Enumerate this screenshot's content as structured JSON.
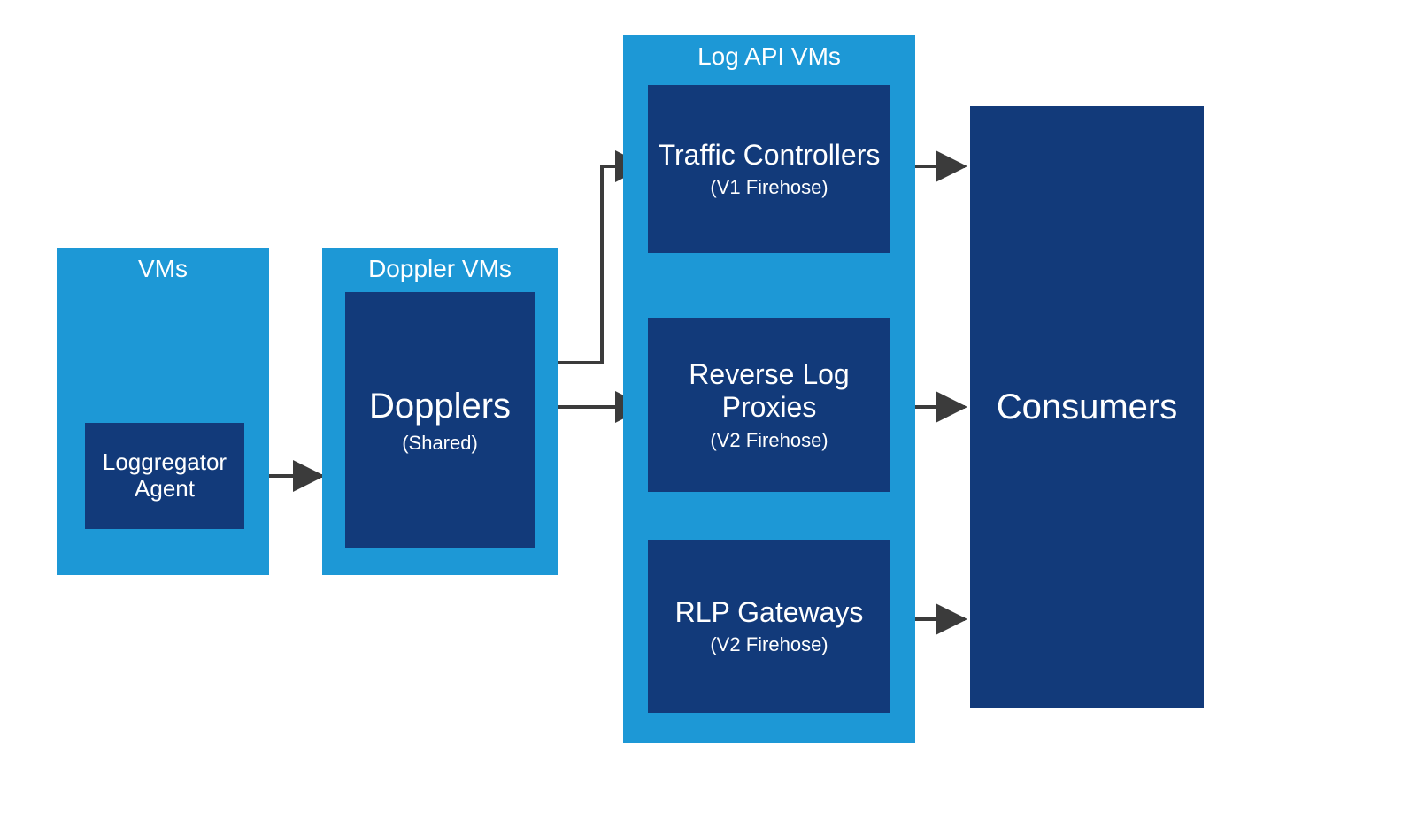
{
  "colors": {
    "group_bg": "#1d98d6",
    "node_bg": "#123a7a",
    "arrow": "#3b3b3b",
    "text": "#ffffff"
  },
  "groups": {
    "vms": {
      "title": "VMs"
    },
    "doppler": {
      "title": "Doppler VMs"
    },
    "logapi": {
      "title": "Log API VMs"
    }
  },
  "nodes": {
    "loggregator": {
      "title": "Loggregator Agent",
      "subtitle": ""
    },
    "dopplers": {
      "title": "Dopplers",
      "subtitle": "(Shared)"
    },
    "traffic": {
      "title": "Traffic Controllers",
      "subtitle": "(V1 Firehose)"
    },
    "rlp": {
      "title": "Reverse Log Proxies",
      "subtitle": "(V2 Firehose)"
    },
    "rlpgw": {
      "title": "RLP Gateways",
      "subtitle": "(V2 Firehose)"
    },
    "consumers": {
      "title": "Consumers",
      "subtitle": ""
    }
  },
  "edges": [
    {
      "from": "loggregator",
      "to": "dopplers"
    },
    {
      "from": "dopplers",
      "to": "traffic"
    },
    {
      "from": "dopplers",
      "to": "rlp"
    },
    {
      "from": "rlp",
      "to": "rlpgw"
    },
    {
      "from": "traffic",
      "to": "consumers"
    },
    {
      "from": "rlp",
      "to": "consumers"
    },
    {
      "from": "rlpgw",
      "to": "consumers"
    }
  ]
}
